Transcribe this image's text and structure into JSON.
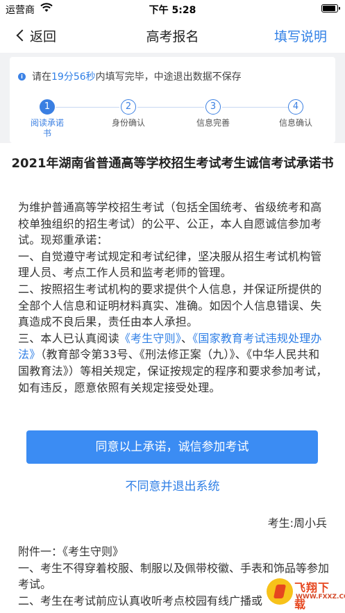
{
  "status_bar": {
    "carrier": "运营商",
    "time": "下午 5:28"
  },
  "nav": {
    "back_label": "返回",
    "title": "高考报名",
    "help_label": "填写说明"
  },
  "notice": {
    "prefix": "请在",
    "countdown": "19分56秒",
    "suffix": "内填写完毕，中途退出数据不保存"
  },
  "steps": [
    {
      "number": "1",
      "label": "阅读承诺书",
      "active": true
    },
    {
      "number": "2",
      "label": "身份确认",
      "active": false
    },
    {
      "number": "3",
      "label": "信息完善",
      "active": false
    },
    {
      "number": "4",
      "label": "信息确认",
      "active": false
    }
  ],
  "document": {
    "title": "2021年湖南省普通高等学校招生考试考生诚信考试承诺书",
    "intro": "为维护普通高等学校招生考试（包括全国统考、省级统考和高校单独组织的招生考试）的公平、公正，本人自愿诚信参加考试。现郑重承诺：",
    "item1": "一、自觉遵守考试规定和考试纪律，坚决服从招生考试机构管理人员、考点工作人员和监考老师的管理。",
    "item2": "二、按照招生考试机构的要求提供个人信息，并保证所提供的全部个人信息和证明材料真实、准确。如因个人信息错误、失真造成不良后果，责任由本人承担。",
    "item3_prefix": "三、本人已认真阅读",
    "item3_link1": "《考生守则》",
    "item3_sep": "、",
    "item3_link2": "《国家教育考试违规处理办法》",
    "item3_suffix": "（教育部令第33号、《刑法修正案（九）》、《中华人民共和国教育法》）等相关规定，保证按规定的程序和要求参加考试，如有违反，愿意依照有关规定接受处理。"
  },
  "actions": {
    "agree_label": "同意以上承诺，诚信参加考试",
    "disagree_label": "不同意并退出系统"
  },
  "examinee": "考生:周小兵",
  "appendix": {
    "heading": "附件一：《考生守则》",
    "line1": "一、考生不得穿着校服、制服以及佩带校徽、手表和饰品等参加考试。",
    "line2": "二、考生在考试前应认真收听考点校园有线广播或"
  },
  "watermark": {
    "text": "飞翔下载",
    "sub": "WWW.FXXZ.COM"
  },
  "colors": {
    "accent": "#2f7fe6",
    "button": "#3b8cf3"
  }
}
